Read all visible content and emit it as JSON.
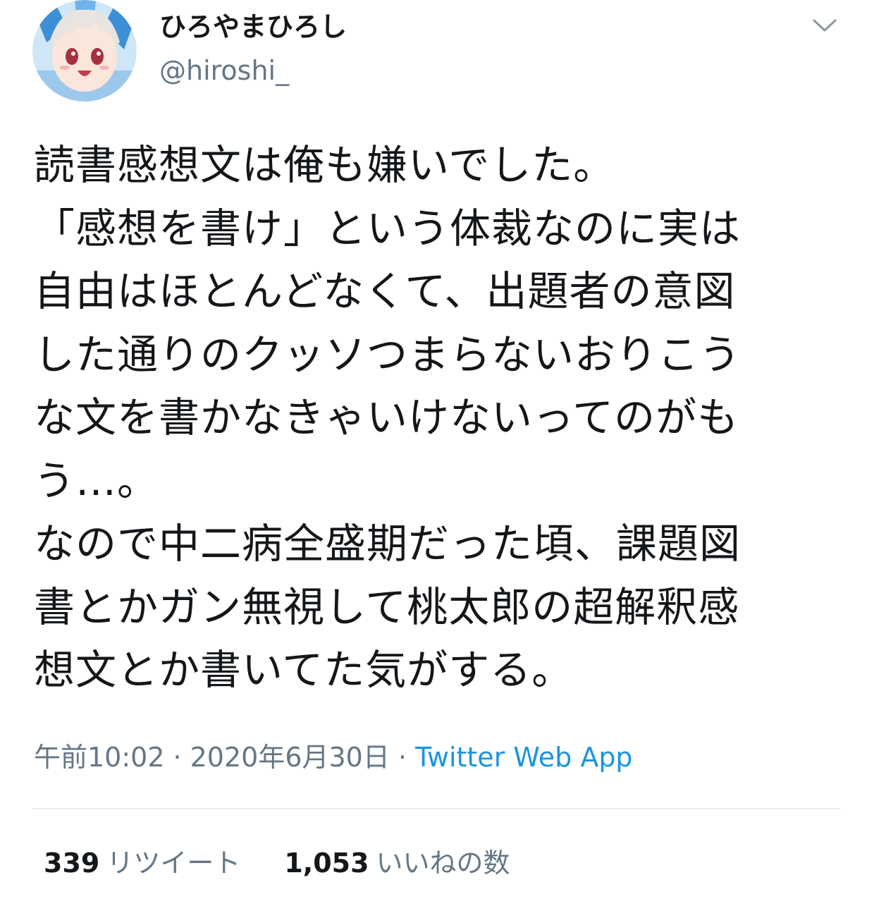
{
  "user": {
    "display_name": "ひろやまひろし",
    "handle": "@hiroshi_",
    "avatar_icon": "anime-avatar-icon"
  },
  "header": {
    "more_icon": "chevron-down-icon"
  },
  "tweet": {
    "lines": [
      "読書感想文は俺も嫌いでした。",
      "「感想を書け」という体裁なのに実は",
      "自由はほとんどなくて、出題者の意図",
      "した通りのクッソつまらないおりこう",
      "な文を書かなきゃいけないってのがも",
      "う…。",
      "なので中二病全盛期だった頃、課題図",
      "書とかガン無視して桃太郎の超解釈感",
      "想文とか書いてた気がする。"
    ]
  },
  "meta": {
    "time": "午前10:02",
    "separator": "·",
    "date": "2020年6月30日",
    "source": "Twitter Web App"
  },
  "stats": {
    "retweets_count": "339",
    "retweets_label": "リツイート",
    "likes_count": "1,053",
    "likes_label": "いいねの数"
  },
  "colors": {
    "text": "#14171a",
    "secondary": "#657786",
    "link": "#1b95e0",
    "divider": "#e6ecf0"
  }
}
